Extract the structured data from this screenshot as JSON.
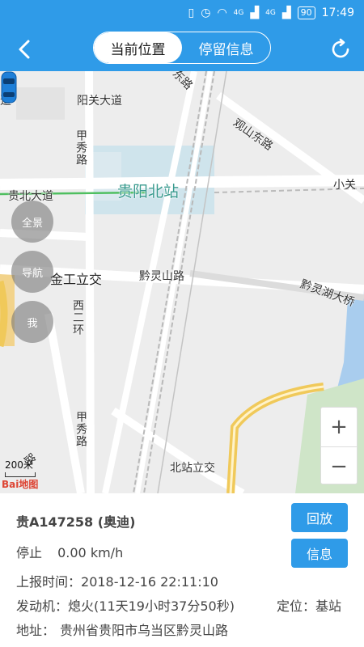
{
  "status_bar": {
    "icons": [
      "vibrate-icon",
      "alarm-icon",
      "wifi-icon",
      "signal-4g-icon",
      "signal-4g-icon"
    ],
    "network_1": "4G",
    "network_2": "4G",
    "battery": "90",
    "time": "17:49"
  },
  "header": {
    "tab_current": "当前位置",
    "tab_stay": "停留信息",
    "colors": {
      "accent": "#2f9be8"
    }
  },
  "map": {
    "labels": {
      "road_dao": "道",
      "yangguan": "阳关大道",
      "dongroad": "东路",
      "guanshan": "观山东路",
      "jiaxiu_top": "甲秀路",
      "station": "贵阳北站",
      "guibei": "贵北大道",
      "xiaoguan": "小关",
      "jingong": "金工立交",
      "qianling": "黔灵山路",
      "qianlinghu": "黔灵湖大桥",
      "xierhuan": "西二环",
      "jiaxiu_bottom": "甲秀路",
      "beizhan": "北站立交",
      "bottom_road": "路"
    },
    "buttons": {
      "overview": "全景",
      "navigation": "导航",
      "me": "我"
    },
    "zoom_in": "+",
    "zoom_out": "−",
    "scale": "200米",
    "logo": "Bai地图"
  },
  "vehicle": {
    "plate": "贵A147258 (奥迪)",
    "state": "停止",
    "speed": "0.00 km/h",
    "report_label": "上报时间：",
    "report_time": "2018-12-16 22:11:10",
    "engine_label": "发动机：",
    "engine": "熄火(11天19小时37分50秒)",
    "locate_label": "定位：",
    "locate": "基站",
    "address_label": "地址：",
    "address": "贵州省贵阳市乌当区黔灵山路",
    "playback_button": "回放",
    "info_button": "信息"
  }
}
